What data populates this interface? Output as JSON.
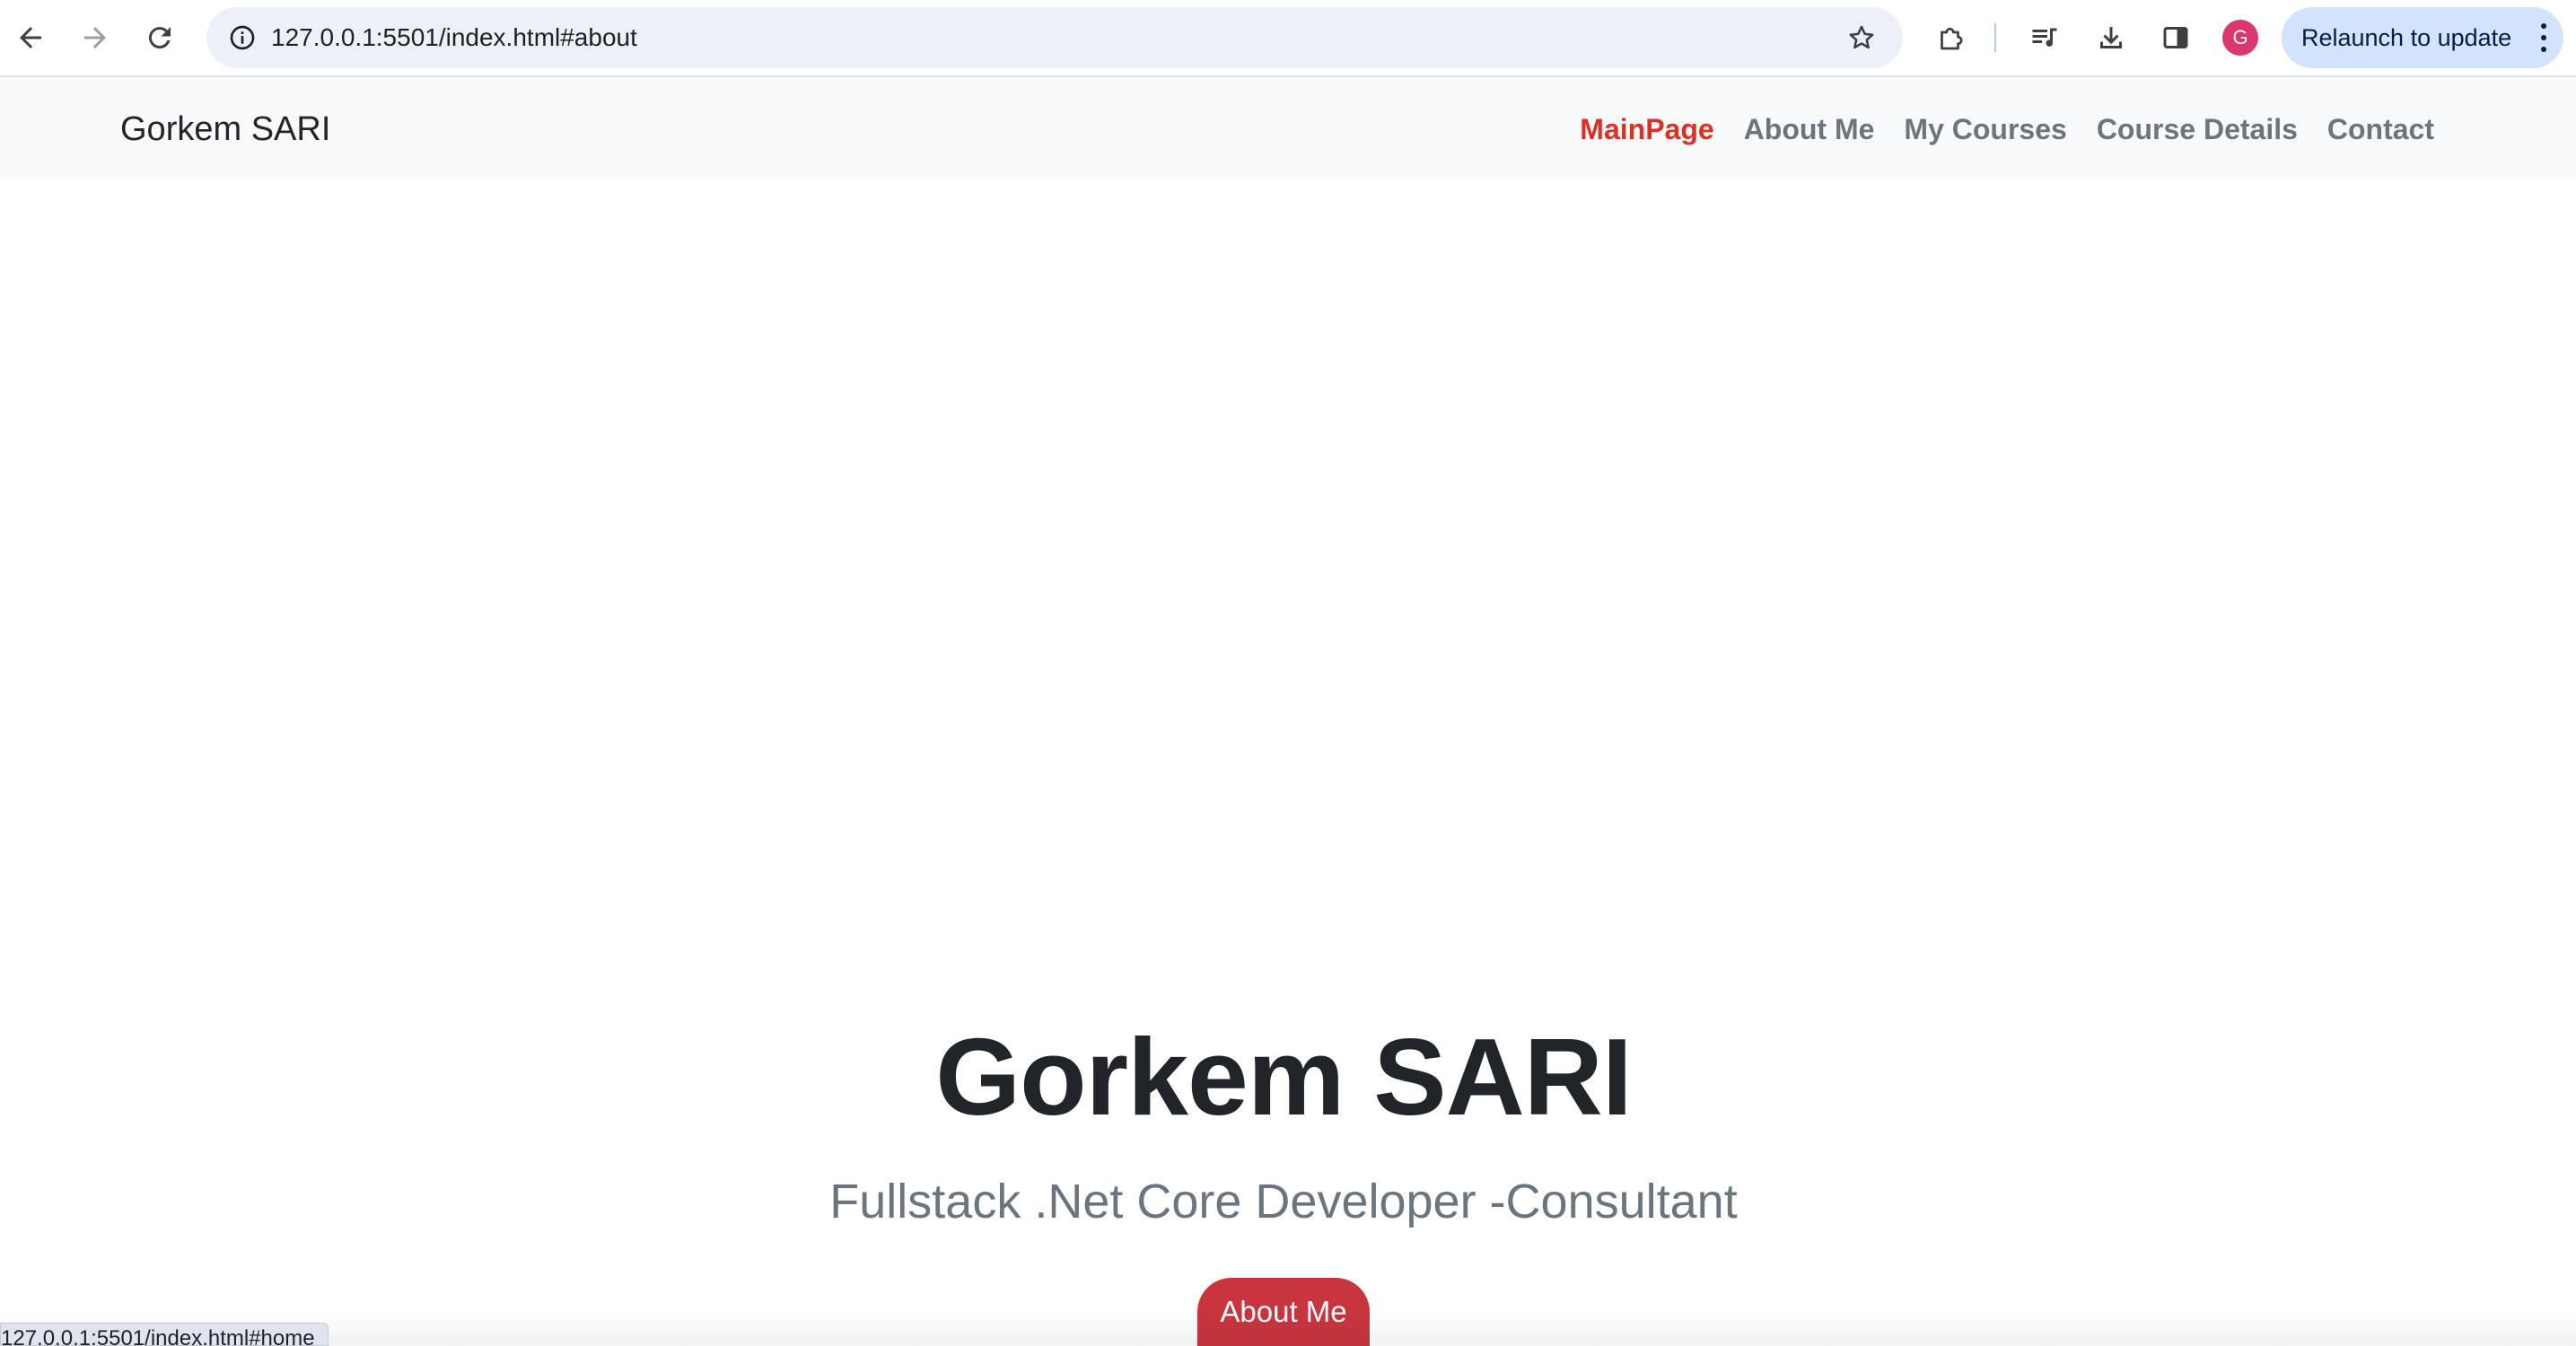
{
  "browser": {
    "url": "127.0.0.1:5501/index.html#about",
    "avatar_letter": "G",
    "relaunch_label": "Relaunch to update",
    "status_url": "127.0.0.1:5501/index.html#home"
  },
  "navbar": {
    "brand": "Gorkem SARI",
    "items": [
      {
        "label": "MainPage",
        "active": true
      },
      {
        "label": "About Me",
        "active": false
      },
      {
        "label": "My Courses",
        "active": false
      },
      {
        "label": "Course Details",
        "active": false
      },
      {
        "label": "Contact",
        "active": false
      }
    ]
  },
  "hero": {
    "title": "Gorkem SARI",
    "subtitle": "Fullstack .Net Core Developer -Consultant",
    "button_label": "About Me"
  },
  "colors": {
    "active_nav": "#dc3023",
    "button": "#c9353f",
    "avatar": "#d9376e",
    "relaunch_bg": "#d3e3fd"
  }
}
